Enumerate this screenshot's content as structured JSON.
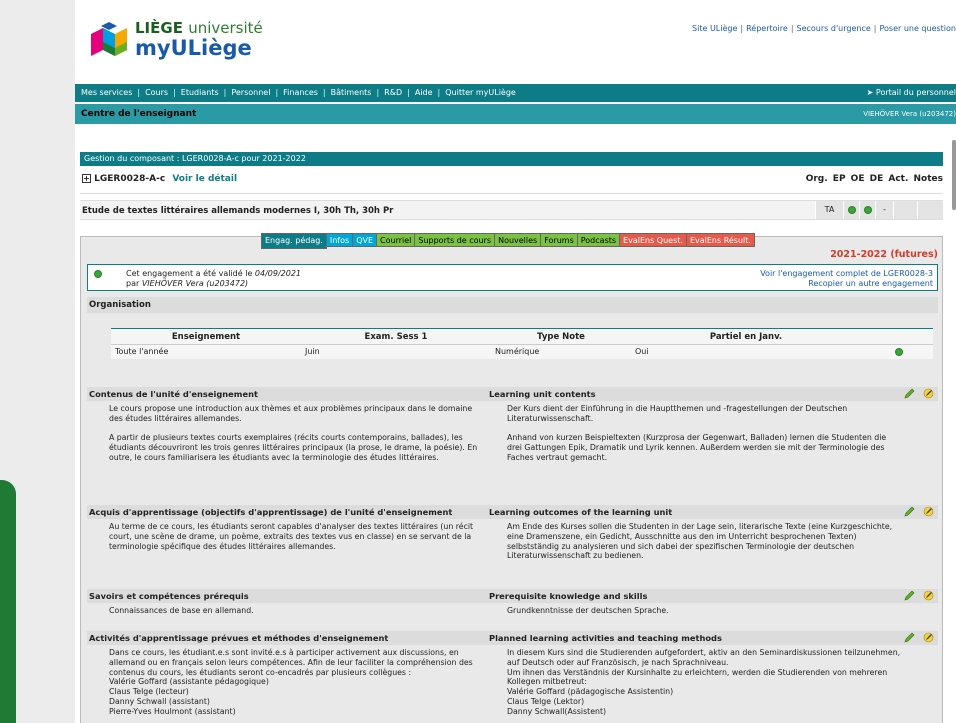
{
  "header": {
    "logo_line1": "LIÈGE",
    "logo_line1b": "université",
    "logo_line2": "myULiège",
    "top_links": [
      "Site ULiège",
      "Répertoire",
      "Secours d'urgence",
      "Poser une question"
    ]
  },
  "nav": {
    "items": [
      "Mes services",
      "Cours",
      "Etudiants",
      "Personnel",
      "Finances",
      "Bâtiments",
      "R&D",
      "Aide",
      "Quitter myULiège"
    ],
    "portal": "➤  Portail du personnel"
  },
  "subbar": {
    "title": "Centre de l'enseignant",
    "user": "VIEHÖVER Vera (u203472)"
  },
  "component": {
    "header": "Gestion du composant : LGER0028-A-c pour 2021-2022",
    "plus": "+",
    "code": "LGER0028-A-c",
    "detail_link": "Voir le détail",
    "columns": "Org.  EP  OE  DE   Act.  Notes",
    "course_title": "Etude de textes littéraires allemands modernes I, 30h Th, 30h Pr",
    "org_value": "TA",
    "de_value": "-"
  },
  "tabs": [
    {
      "label": "Engag. pédag.",
      "style": "active"
    },
    {
      "label": "Infos",
      "style": "blue"
    },
    {
      "label": "QVE",
      "style": "blue"
    },
    {
      "label": "Courriel",
      "style": "green"
    },
    {
      "label": "Supports de cours",
      "style": "green"
    },
    {
      "label": "Nouvelles",
      "style": "green"
    },
    {
      "label": "Forums",
      "style": "green"
    },
    {
      "label": "Podcasts",
      "style": "green"
    },
    {
      "label": "EvalEns Quest.",
      "style": "red"
    },
    {
      "label": "EvalEns Résult.",
      "style": "red"
    }
  ],
  "year_label": "2021-2022 (futures)",
  "validation": {
    "line1_prefix": "Cet engagement a été validé le ",
    "line1_date": "04/09/2021",
    "line2_prefix": "par ",
    "line2_user": "VIEHÖVER Vera (u203472)",
    "link1": "Voir l'engagement complet de LGER0028-3",
    "link2": "Recopier un autre engagement"
  },
  "organisation": {
    "title": "Organisation",
    "headers": [
      "Enseignement",
      "Exam. Sess 1",
      "Type Note",
      "Partiel en Janv."
    ],
    "row": [
      "Toute l'année",
      "Juin",
      "Numérique",
      "Oui"
    ]
  },
  "sections": [
    {
      "fr_title": "Contenus de l'unité d'enseignement",
      "en_title": "Learning unit contents",
      "fr_text": "Le cours propose une introduction aux thèmes et aux problèmes principaux dans le domaine des études littéraires allemandes.\n\nA partir de plusieurs textes courts exemplaires (récits courts contemporains, ballades), les étudiants découvriront les trois genres littéraires principaux (la prose, le drame, la poésie). En outre, le cours familiarisera les étudiants avec la terminologie des études littéraires.",
      "en_text": "Der Kurs dient der Einführung in die Hauptthemen und -fragestellungen der Deutschen Literaturwissenschaft.\n\nAnhand von kurzen Beispieltexten (Kurzprosa der Gegenwart, Balladen) lernen die Studenten die drei Gattungen Epik, Dramatik und Lyrik kennen. Außerdem werden sie mit der Terminologie des Faches vertraut gemacht."
    },
    {
      "fr_title": "Acquis d'apprentissage (objectifs d'apprentissage) de l'unité d'enseignement",
      "en_title": "Learning outcomes of the learning unit",
      "fr_text": "Au terme de ce cours, les étudiants seront capables d'analyser des textes littéraires (un récit court, une scène de drame, un poème, extraits des textes vus en classe) en se servant de la terminologie spécifique des études littéraires allemandes.",
      "en_text": "Am Ende des Kurses sollen die Studenten in der Lage sein, literarische Texte (eine Kurzgeschichte, eine Dramenszene, ein Gedicht, Ausschnitte aus den im Unterricht besprochenen Texten) selbstständig zu analysieren und sich dabei der spezifischen Terminologie der deutschen Literaturwissenschaft zu bedienen."
    },
    {
      "fr_title": "Savoirs et compétences prérequis",
      "en_title": "Prerequisite knowledge and skills",
      "fr_text": "Connaissances de base en allemand.",
      "en_text": "Grundkenntnisse der deutschen Sprache."
    },
    {
      "fr_title": "Activités d'apprentissage prévues et méthodes d'enseignement",
      "en_title": "Planned learning activities and teaching methods",
      "fr_text": "Dans ce cours, les étudiant.e.s sont invité.e.s à participer activement aux discussions, en allemand ou en français selon leurs compétences. Afin de leur faciliter la compréhension des contenus du cours, les étudiants seront co-encadrés par plusieurs collègues :\nValérie Goffard (assistante pédagogique)\nClaus Telge (lecteur)\nDanny Schwall (assistant)\nPierre-Yves Houlmont (assistant)",
      "en_text": "In diesem Kurs sind die Studierenden aufgefordert, aktiv an den Seminardiskussionen teilzunehmen, auf Deutsch oder auf Französisch, je nach Sprachniveau.\nUm ihnen das Verständnis der Kursinhalte zu erleichtern, werden die Studierenden von mehreren Kollegen mitbetreut:\nValérie Goffard (pädagogische Assistentin)\nClaus Telge (Lektor)\nDanny Schwall(Assistent)"
    }
  ]
}
